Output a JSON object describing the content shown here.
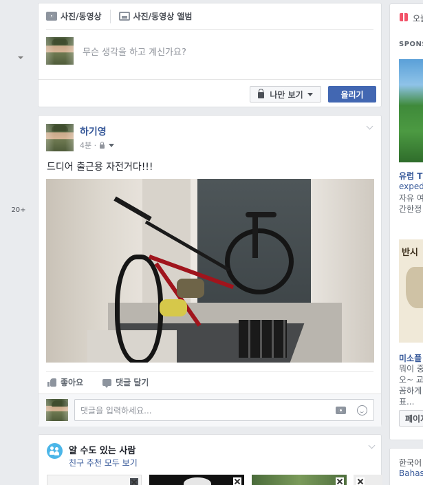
{
  "left_nav": {
    "more_count": "20+"
  },
  "composer": {
    "tab_photo_video": "사진/동영상",
    "tab_photo_album": "사진/동영상 앨범",
    "placeholder": "무슨 생각을 하고 계신가요?",
    "privacy_label": "나만 보기",
    "post_button": "올리기"
  },
  "post": {
    "author": "하기영",
    "time": "4분 ·",
    "text": "드디어 출근용 자전거다!!!",
    "like_label": "좋아요",
    "comment_label": "댓글 달기",
    "comment_placeholder": "댓글을 입력하세요..."
  },
  "pymk": {
    "title": "알 수도 있는 사람",
    "see_all": "친구 추천 모두 보기"
  },
  "right_column": {
    "top_title": "오늘",
    "sponsored": "SPONSORED",
    "ad1": {
      "headline": "유럽 TO",
      "domain": "expedia",
      "text_line1": "자유 여",
      "text_line2": "간한정"
    },
    "ad2": {
      "image_text": "반시",
      "headline": "미소플",
      "text_line1": "뭐이 중",
      "text_line2": "오~ 교",
      "text_line3": "꼼하게",
      "text_line4": "표..."
    },
    "ad_button": "페이지",
    "lang_current": "한국어",
    "lang_other": "Bahasa"
  }
}
